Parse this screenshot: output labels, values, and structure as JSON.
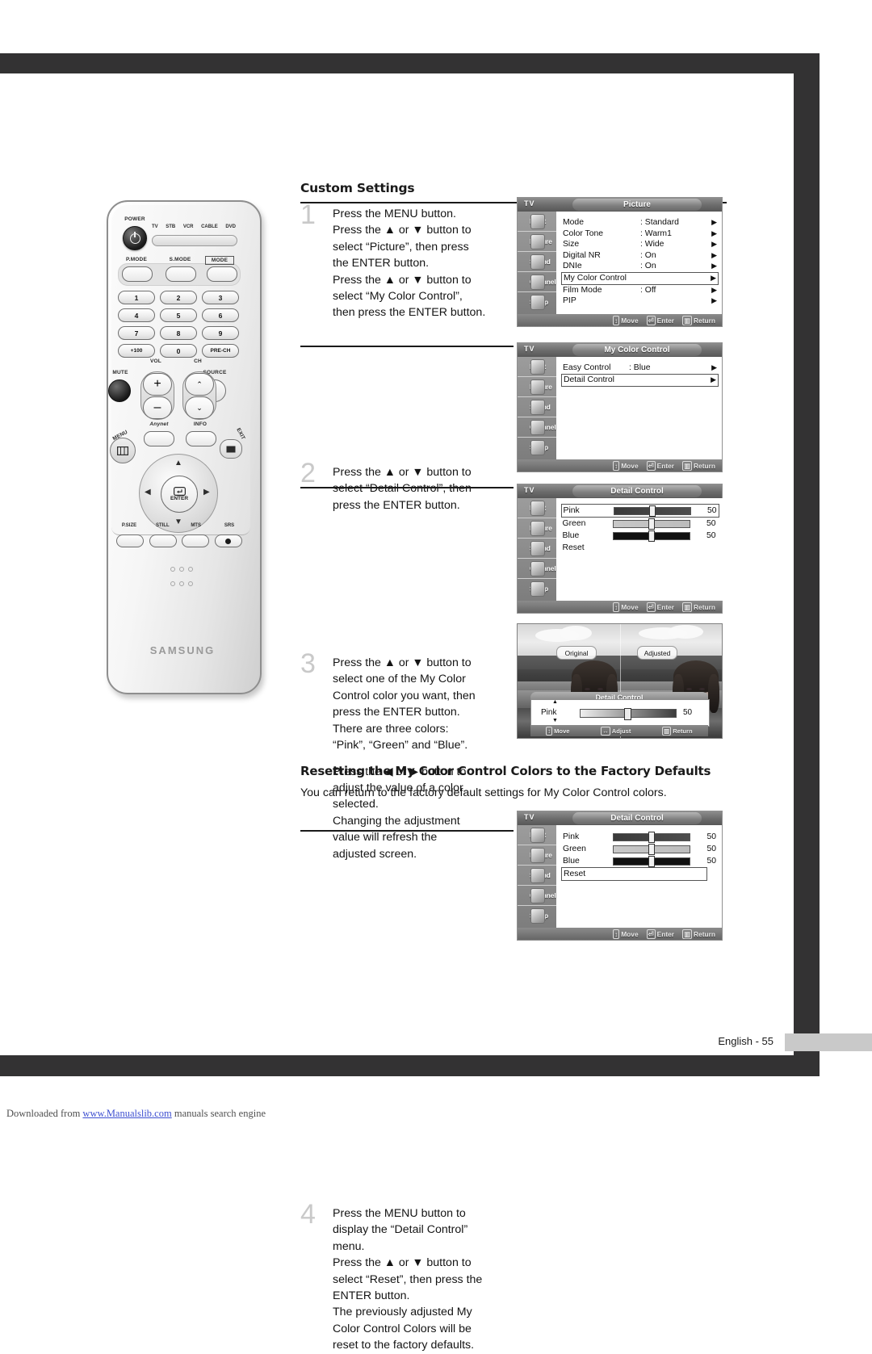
{
  "page": {
    "section_title": "Custom Settings",
    "reset_heading": "Resetting the My Color Control Colors to the Factory Defaults",
    "reset_intro": "You can return to the factory default settings for My Color Control colors.",
    "page_label": "English - 55",
    "download_prefix": "Downloaded from ",
    "download_link": "www.Manualslib.com",
    "download_suffix": " manuals search engine"
  },
  "steps": [
    {
      "number": "1",
      "lines": [
        "Press the MENU button.",
        "Press the ▲ or ▼ button to",
        "select “Picture”, then press",
        "the ENTER button.",
        "Press the ▲ or ▼ button to",
        "select “My Color Control”,",
        "then press the ENTER button."
      ]
    },
    {
      "number": "2",
      "lines": [
        "Press the ▲ or ▼ button to",
        "select “Detail Control”, then",
        "press the ENTER button."
      ]
    },
    {
      "number": "3",
      "lines": [
        "Press the ▲ or ▼ button to",
        "select one of the My Color",
        "Control color you want, then",
        "press the ENTER button.",
        "There are three colors:",
        "“Pink”, “Green” and “Blue”."
      ],
      "lines2": [
        "Press the ◀ or ▶ button to",
        "adjust the value of a color",
        "selected.",
        "Changing the adjustment",
        "value will refresh the",
        "adjusted screen."
      ]
    },
    {
      "number": "4",
      "lines": [
        "Press the MENU button to",
        "display the “Detail Control”",
        "menu.",
        "Press the ▲ or ▼ button to",
        "select “Reset”, then press the",
        "ENTER button.",
        "The previously adjusted My",
        "Color Control Colors will be",
        "reset to the factory defaults."
      ]
    }
  ],
  "osd_common": {
    "tv_label": "TV",
    "sidebar": [
      "Input",
      "Picture",
      "Sound",
      "Channel",
      "Setup"
    ],
    "footer": {
      "move": "Move",
      "enter": "Enter",
      "return": "Return",
      "adjust": "Adjust"
    }
  },
  "menu_picture": {
    "title": "Picture",
    "rows": [
      {
        "label": "Mode",
        "value": ": Standard",
        "arrow": "▶",
        "selected": false
      },
      {
        "label": "Color Tone",
        "value": ": Warm1",
        "arrow": "▶",
        "selected": false
      },
      {
        "label": "Size",
        "value": ": Wide",
        "arrow": "▶",
        "selected": false
      },
      {
        "label": "Digital NR",
        "value": ": On",
        "arrow": "▶",
        "selected": false
      },
      {
        "label": "DNIe",
        "value": ": On",
        "arrow": "▶",
        "selected": false
      },
      {
        "label": "My Color Control",
        "value": "",
        "arrow": "▶",
        "selected": true
      },
      {
        "label": "Film Mode",
        "value": ": Off",
        "arrow": "▶",
        "selected": false
      },
      {
        "label": "PIP",
        "value": "",
        "arrow": "▶",
        "selected": false
      }
    ]
  },
  "menu_mycolor": {
    "title": "My Color Control",
    "rows": [
      {
        "label": "Easy Control",
        "value": ": Blue",
        "arrow": "▶",
        "selected": false
      },
      {
        "label": "Detail Control",
        "value": "",
        "arrow": "▶",
        "selected": true
      }
    ]
  },
  "menu_detail": {
    "title": "Detail Control",
    "sliders": [
      {
        "label": "Pink",
        "value": "50",
        "selected": true
      },
      {
        "label": "Green",
        "value": "50",
        "selected": false
      },
      {
        "label": "Blue",
        "value": "50",
        "selected": false
      }
    ],
    "reset_label": "Reset",
    "reset_selected": false
  },
  "menu_detail_reset": {
    "title": "Detail Control",
    "sliders": [
      {
        "label": "Pink",
        "value": "50",
        "selected": false
      },
      {
        "label": "Green",
        "value": "50",
        "selected": false
      },
      {
        "label": "Blue",
        "value": "50",
        "selected": false
      }
    ],
    "reset_label": "Reset",
    "reset_selected": true
  },
  "preview": {
    "original_label": "Original",
    "adjusted_label": "Adjusted",
    "osd_title": "Detail Control",
    "slider_label": "Pink",
    "slider_value": "50",
    "up_arrow": "▲",
    "down_arrow": "▼",
    "footer": {
      "move": "Move",
      "adjust": "Adjust",
      "return": "Return"
    }
  },
  "remote": {
    "brand": "SAMSUNG",
    "power_label": "POWER",
    "mode_tags": [
      "TV",
      "STB",
      "VCR",
      "CABLE",
      "DVD"
    ],
    "mode_buttons": [
      "P.MODE",
      "S.MODE",
      "MODE"
    ],
    "keys": [
      [
        "1",
        "2",
        "3"
      ],
      [
        "4",
        "5",
        "6"
      ],
      [
        "7",
        "8",
        "9"
      ],
      [
        "+100",
        "0",
        "PRE-CH"
      ]
    ],
    "vol_label": "VOL",
    "ch_label": "CH",
    "mute_label": "MUTE",
    "source_label": "SOURCE",
    "anynet_label": "Anynet",
    "info_label": "INFO",
    "menu_label": "MENU",
    "exit_label": "EXIT",
    "enter_label": "ENTER",
    "bottom_keys": [
      "P.SIZE",
      "STILL",
      "MTS",
      "SRS"
    ],
    "dpad": {
      "up": "▲",
      "down": "▼",
      "left": "◀",
      "right": "▶"
    }
  }
}
